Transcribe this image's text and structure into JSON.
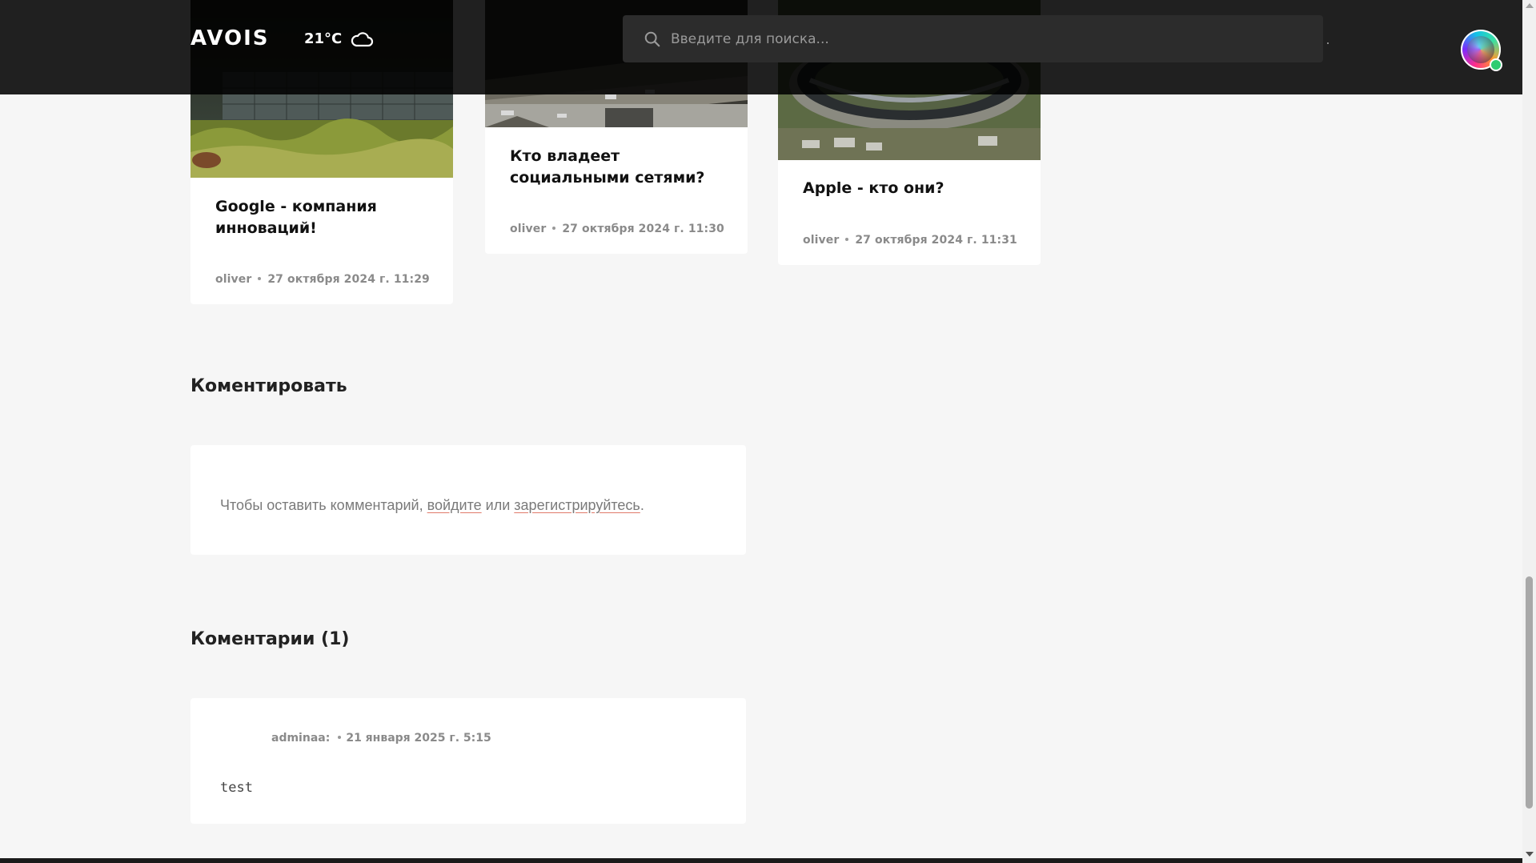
{
  "header": {
    "logo": "AVOIS",
    "weather": {
      "temp": "21°C",
      "icon": "cloud-icon"
    },
    "search": {
      "placeholder": "Введите для поиска..."
    },
    "avatar": {
      "status": "online"
    }
  },
  "cards": [
    {
      "title": "Google - компания инноваций!",
      "author": "oliver",
      "date": "27 октября 2024 г. 11:29"
    },
    {
      "title": "Кто владеет социальными сетями?",
      "author": "oliver",
      "date": "27 октября 2024 г. 11:30"
    },
    {
      "title": "Apple - кто они?",
      "author": "oliver",
      "date": "27 октября 2024 г. 11:31"
    }
  ],
  "comment_form": {
    "heading": "Коментировать",
    "text_before": "Чтобы оставить комментарий,",
    "login_link": "войдите",
    "text_middle": "или",
    "register_link": "зарегистрируйтесь",
    "text_end": "."
  },
  "comments_section": {
    "heading": "Коментарии (1)",
    "items": [
      {
        "author": "adminaa:",
        "date": "21 января 2025 г. 5:15",
        "text": "test"
      }
    ]
  },
  "colors": {
    "header_bg": "#000000",
    "link_underline": "#e07a6a",
    "online": "#2ecc71"
  }
}
